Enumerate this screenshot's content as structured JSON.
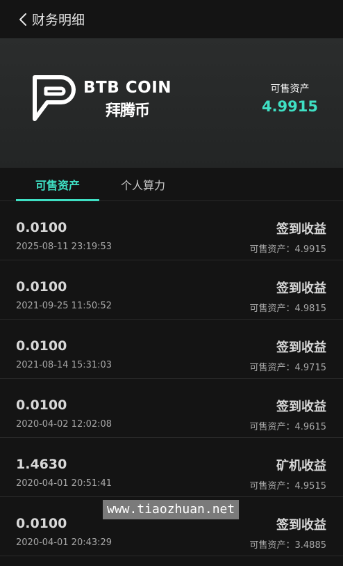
{
  "header": {
    "title": "财务明细"
  },
  "banner": {
    "logo_en": "BTB COIN",
    "logo_cn": "拜腾币",
    "asset_label": "可售资产",
    "asset_value": "4.9915"
  },
  "tabs": [
    {
      "label": "可售资产",
      "active": true
    },
    {
      "label": "个人算力",
      "active": false
    }
  ],
  "records": [
    {
      "amount": "0.0100",
      "time": "2025-08-11 23:19:53",
      "type": "签到收益",
      "balance": "可售资产：4.9915"
    },
    {
      "amount": "0.0100",
      "time": "2021-09-25 11:50:52",
      "type": "签到收益",
      "balance": "可售资产：4.9815"
    },
    {
      "amount": "0.0100",
      "time": "2021-08-14 15:31:03",
      "type": "签到收益",
      "balance": "可售资产：4.9715"
    },
    {
      "amount": "0.0100",
      "time": "2020-04-02 12:02:08",
      "type": "签到收益",
      "balance": "可售资产：4.9615"
    },
    {
      "amount": "1.4630",
      "time": "2020-04-01 20:51:41",
      "type": "矿机收益",
      "balance": "可售资产：4.9515"
    },
    {
      "amount": "0.0100",
      "time": "2020-04-01 20:43:29",
      "type": "签到收益",
      "balance": "可售资产：3.4885"
    }
  ],
  "watermark": "www.tiaozhuan.net",
  "colors": {
    "accent": "#3fe0c4",
    "background": "#141414",
    "banner": "#2b2d2d"
  }
}
